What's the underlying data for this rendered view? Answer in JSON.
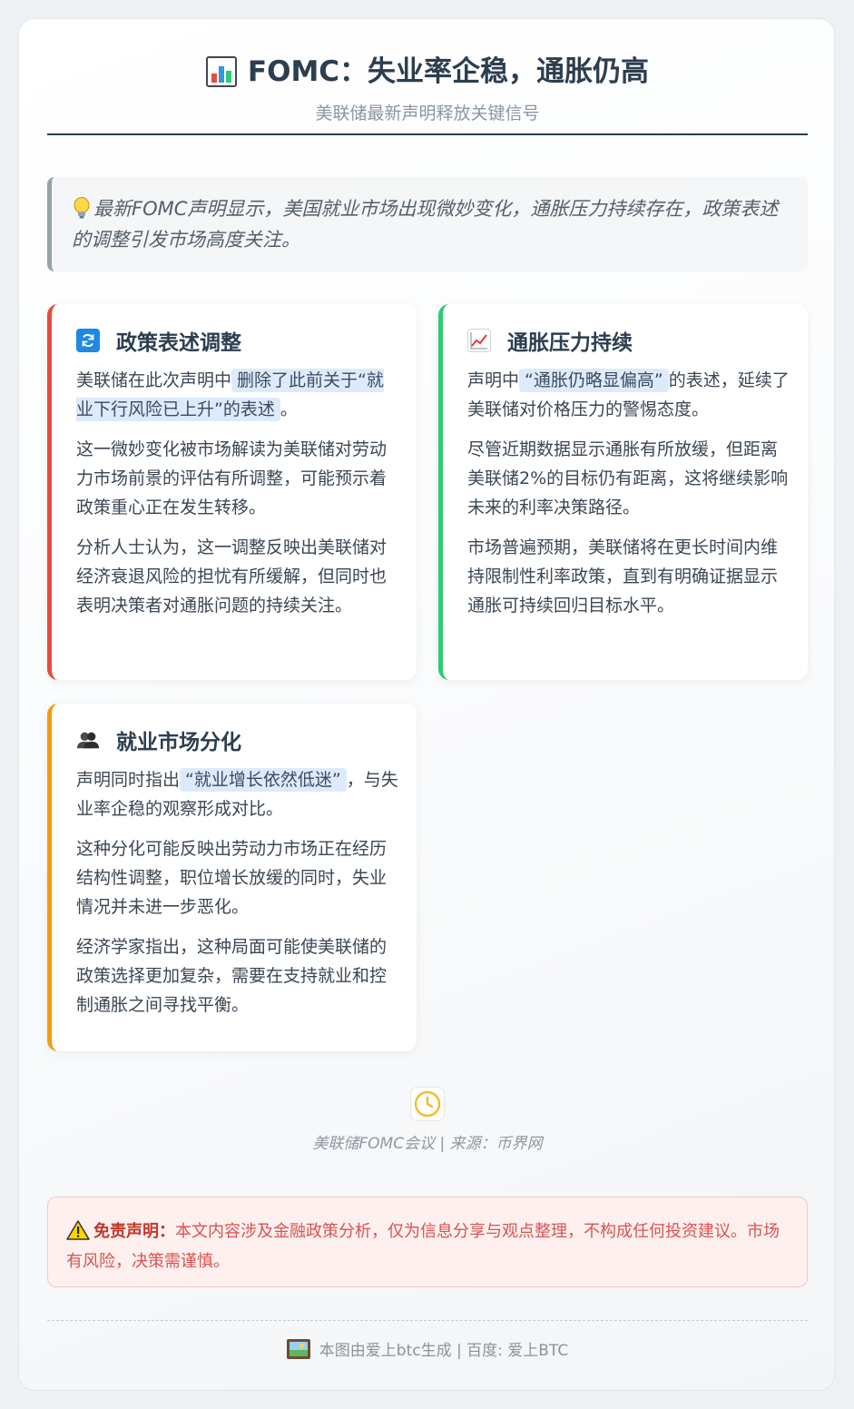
{
  "header": {
    "title": "FOMC：失业率企稳，通胀仍高",
    "subtitle": "美联储最新声明释放关键信号",
    "icon": "bar-chart-icon"
  },
  "intro": {
    "text": "最新FOMC声明显示，美国就业市场出现微妙变化，通胀压力持续存在，政策表述的调整引发市场高度关注。",
    "icon": "lightbulb-icon"
  },
  "cards": {
    "policy": {
      "title": "政策表述调整",
      "icon": "refresh-icon",
      "accent": "#e74c3c",
      "p1_before": "美联储在此次声明中",
      "p1_highlight": "删除了此前关于“就业下行风险已上升”的表述",
      "p1_after": "。",
      "p2": "这一微妙变化被市场解读为美联储对劳动力市场前景的评估有所调整，可能预示着政策重心正在发生转移。",
      "p3": "分析人士认为，这一调整反映出美联储对经济衰退风险的担忧有所缓解，但同时也表明决策者对通胀问题的持续关注。"
    },
    "inflation": {
      "title": "通胀压力持续",
      "icon": "trend-up-icon",
      "accent": "#2ecc71",
      "p1_before": "声明中",
      "p1_highlight": "“通胀仍略显偏高”",
      "p1_after": "的表述，延续了美联储对价格压力的警惕态度。",
      "p2": "尽管近期数据显示通胀有所放缓，但距离美联储2%的目标仍有距离，这将继续影响未来的利率决策路径。",
      "p3": "市场普遍预期，美联储将在更长时间内维持限制性利率政策，直到有明确证据显示通胀可持续回归目标水平。"
    },
    "jobs": {
      "title": "就业市场分化",
      "icon": "people-icon",
      "accent": "#f39c12",
      "p1_before": "声明同时指出",
      "p1_highlight": "“就业增长依然低迷”",
      "p1_after": "，与失业率企稳的观察形成对比。",
      "p2": "这种分化可能反映出劳动力市场正在经历结构性调整，职位增长放缓的同时，失业情况并未进一步恶化。",
      "p3": "经济学家指出，这种局面可能使美联储的政策选择更加复杂，需要在支持就业和控制通胀之间寻找平衡。"
    }
  },
  "meta": {
    "icon": "clock-icon",
    "text": "美联储FOMC会议 | 来源：币界网"
  },
  "disclaimer": {
    "icon": "warning-icon",
    "label": "免责声明：",
    "text": "本文内容涉及金融政策分析，仅为信息分享与观点整理，不构成任何投资建议。市场有风险，决策需谨慎。"
  },
  "footer": {
    "icon": "picture-icon",
    "text": "本图由爱上btc生成 | 百度: 爱上BTC"
  }
}
